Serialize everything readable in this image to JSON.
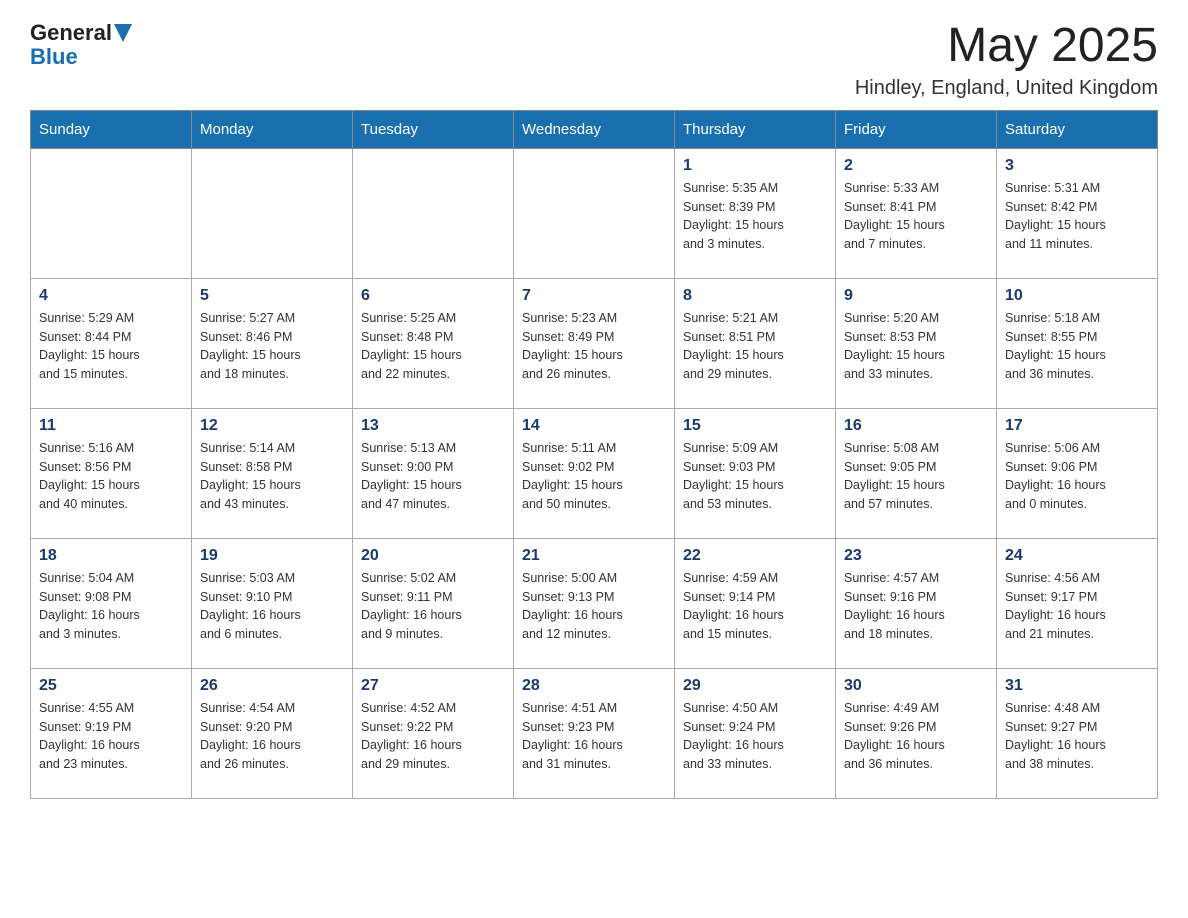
{
  "header": {
    "logo_general": "General",
    "logo_blue": "Blue",
    "month": "May 2025",
    "location": "Hindley, England, United Kingdom"
  },
  "weekdays": [
    "Sunday",
    "Monday",
    "Tuesday",
    "Wednesday",
    "Thursday",
    "Friday",
    "Saturday"
  ],
  "weeks": [
    [
      {
        "day": "",
        "info": ""
      },
      {
        "day": "",
        "info": ""
      },
      {
        "day": "",
        "info": ""
      },
      {
        "day": "",
        "info": ""
      },
      {
        "day": "1",
        "info": "Sunrise: 5:35 AM\nSunset: 8:39 PM\nDaylight: 15 hours\nand 3 minutes."
      },
      {
        "day": "2",
        "info": "Sunrise: 5:33 AM\nSunset: 8:41 PM\nDaylight: 15 hours\nand 7 minutes."
      },
      {
        "day": "3",
        "info": "Sunrise: 5:31 AM\nSunset: 8:42 PM\nDaylight: 15 hours\nand 11 minutes."
      }
    ],
    [
      {
        "day": "4",
        "info": "Sunrise: 5:29 AM\nSunset: 8:44 PM\nDaylight: 15 hours\nand 15 minutes."
      },
      {
        "day": "5",
        "info": "Sunrise: 5:27 AM\nSunset: 8:46 PM\nDaylight: 15 hours\nand 18 minutes."
      },
      {
        "day": "6",
        "info": "Sunrise: 5:25 AM\nSunset: 8:48 PM\nDaylight: 15 hours\nand 22 minutes."
      },
      {
        "day": "7",
        "info": "Sunrise: 5:23 AM\nSunset: 8:49 PM\nDaylight: 15 hours\nand 26 minutes."
      },
      {
        "day": "8",
        "info": "Sunrise: 5:21 AM\nSunset: 8:51 PM\nDaylight: 15 hours\nand 29 minutes."
      },
      {
        "day": "9",
        "info": "Sunrise: 5:20 AM\nSunset: 8:53 PM\nDaylight: 15 hours\nand 33 minutes."
      },
      {
        "day": "10",
        "info": "Sunrise: 5:18 AM\nSunset: 8:55 PM\nDaylight: 15 hours\nand 36 minutes."
      }
    ],
    [
      {
        "day": "11",
        "info": "Sunrise: 5:16 AM\nSunset: 8:56 PM\nDaylight: 15 hours\nand 40 minutes."
      },
      {
        "day": "12",
        "info": "Sunrise: 5:14 AM\nSunset: 8:58 PM\nDaylight: 15 hours\nand 43 minutes."
      },
      {
        "day": "13",
        "info": "Sunrise: 5:13 AM\nSunset: 9:00 PM\nDaylight: 15 hours\nand 47 minutes."
      },
      {
        "day": "14",
        "info": "Sunrise: 5:11 AM\nSunset: 9:02 PM\nDaylight: 15 hours\nand 50 minutes."
      },
      {
        "day": "15",
        "info": "Sunrise: 5:09 AM\nSunset: 9:03 PM\nDaylight: 15 hours\nand 53 minutes."
      },
      {
        "day": "16",
        "info": "Sunrise: 5:08 AM\nSunset: 9:05 PM\nDaylight: 15 hours\nand 57 minutes."
      },
      {
        "day": "17",
        "info": "Sunrise: 5:06 AM\nSunset: 9:06 PM\nDaylight: 16 hours\nand 0 minutes."
      }
    ],
    [
      {
        "day": "18",
        "info": "Sunrise: 5:04 AM\nSunset: 9:08 PM\nDaylight: 16 hours\nand 3 minutes."
      },
      {
        "day": "19",
        "info": "Sunrise: 5:03 AM\nSunset: 9:10 PM\nDaylight: 16 hours\nand 6 minutes."
      },
      {
        "day": "20",
        "info": "Sunrise: 5:02 AM\nSunset: 9:11 PM\nDaylight: 16 hours\nand 9 minutes."
      },
      {
        "day": "21",
        "info": "Sunrise: 5:00 AM\nSunset: 9:13 PM\nDaylight: 16 hours\nand 12 minutes."
      },
      {
        "day": "22",
        "info": "Sunrise: 4:59 AM\nSunset: 9:14 PM\nDaylight: 16 hours\nand 15 minutes."
      },
      {
        "day": "23",
        "info": "Sunrise: 4:57 AM\nSunset: 9:16 PM\nDaylight: 16 hours\nand 18 minutes."
      },
      {
        "day": "24",
        "info": "Sunrise: 4:56 AM\nSunset: 9:17 PM\nDaylight: 16 hours\nand 21 minutes."
      }
    ],
    [
      {
        "day": "25",
        "info": "Sunrise: 4:55 AM\nSunset: 9:19 PM\nDaylight: 16 hours\nand 23 minutes."
      },
      {
        "day": "26",
        "info": "Sunrise: 4:54 AM\nSunset: 9:20 PM\nDaylight: 16 hours\nand 26 minutes."
      },
      {
        "day": "27",
        "info": "Sunrise: 4:52 AM\nSunset: 9:22 PM\nDaylight: 16 hours\nand 29 minutes."
      },
      {
        "day": "28",
        "info": "Sunrise: 4:51 AM\nSunset: 9:23 PM\nDaylight: 16 hours\nand 31 minutes."
      },
      {
        "day": "29",
        "info": "Sunrise: 4:50 AM\nSunset: 9:24 PM\nDaylight: 16 hours\nand 33 minutes."
      },
      {
        "day": "30",
        "info": "Sunrise: 4:49 AM\nSunset: 9:26 PM\nDaylight: 16 hours\nand 36 minutes."
      },
      {
        "day": "31",
        "info": "Sunrise: 4:48 AM\nSunset: 9:27 PM\nDaylight: 16 hours\nand 38 minutes."
      }
    ]
  ]
}
